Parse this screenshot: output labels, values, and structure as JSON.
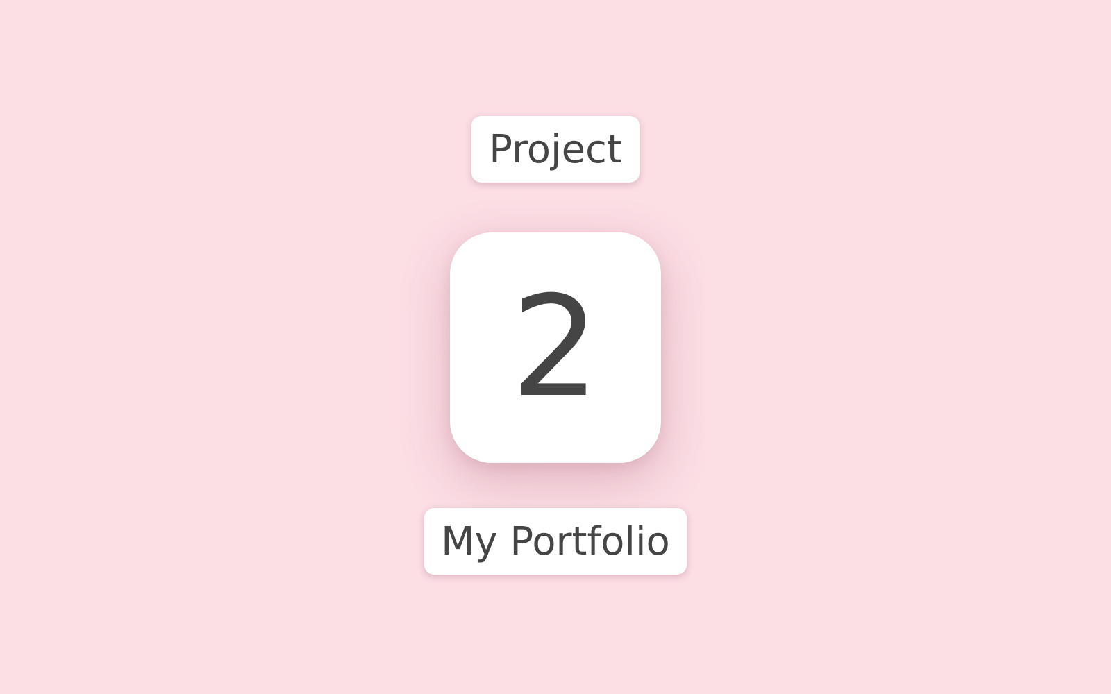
{
  "theme": {
    "background": "#FCDEE5",
    "card": "#FFFFFF",
    "text": "#454545"
  },
  "header_label": "Project",
  "counter": {
    "value": "2"
  },
  "footer_label": "My Portfolio"
}
